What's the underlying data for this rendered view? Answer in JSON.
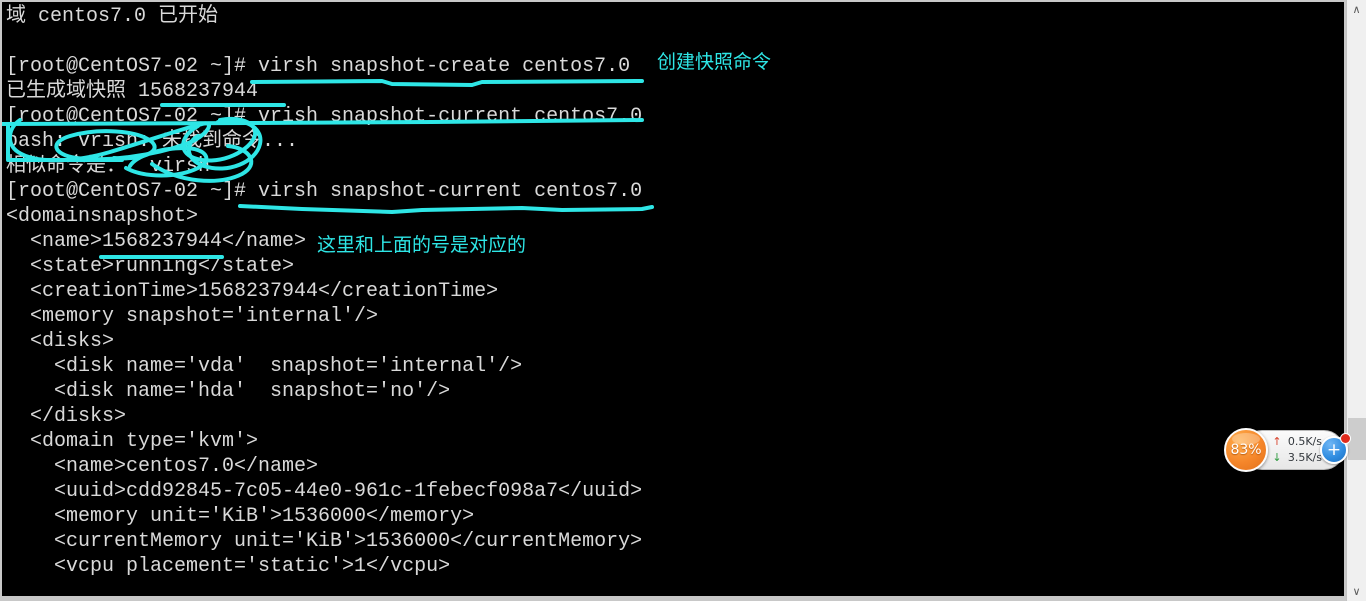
{
  "terminal": {
    "background_color": "#000000",
    "text_color": "#d9d9d9",
    "lines": [
      "域 centos7.0 已开始",
      "",
      "[root@CentOS7-02 ~]# virsh snapshot-create centos7.0",
      "已生成域快照 1568237944",
      "[root@CentOS7-02 ~]# vrish snapshot-current centos7.0",
      "bash: vrish: 未找到命令...",
      "相似命令是：  virsh",
      "[root@CentOS7-02 ~]# virsh snapshot-current centos7.0",
      "<domainsnapshot>",
      "  <name>1568237944</name>",
      "  <state>running</state>",
      "  <creationTime>1568237944</creationTime>",
      "  <memory snapshot='internal'/>",
      "  <disks>",
      "    <disk name='vda'  snapshot='internal'/>",
      "    <disk name='hda'  snapshot='no'/>",
      "  </disks>",
      "  <domain type='kvm'>",
      "    <name>centos7.0</name>",
      "    <uuid>cdd92845-7c05-44e0-961c-1febecf098a7</uuid>",
      "    <memory unit='KiB'>1536000</memory>",
      "    <currentMemory unit='KiB'>1536000</currentMemory>",
      "    <vcpu placement='static'>1</vcpu>"
    ]
  },
  "annotations": {
    "ink_color": "#2ee6e6",
    "create_label": "创建快照命令",
    "match_label": "这里和上面的号是对应的"
  },
  "scrollbar": {
    "up_arrow": "∧",
    "down_arrow": "∨"
  },
  "net_widget": {
    "cpu_percent": "83%",
    "upload_arrow": "↑",
    "upload_rate": "0.5K/s",
    "download_arrow": "↓",
    "download_rate": "3.5K/s",
    "plus_label": "+",
    "accent_color": "#f5862a",
    "button_color": "#2f8ce0",
    "badge_color": "#e02b1d"
  }
}
